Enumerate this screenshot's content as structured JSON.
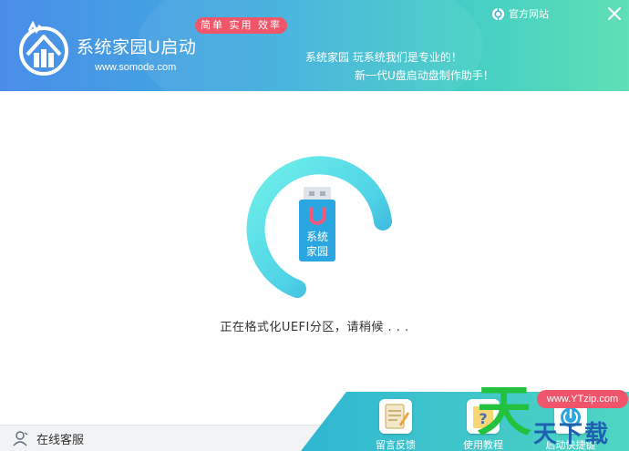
{
  "header": {
    "brand_title": "系统家园U启动",
    "brand_url": "www.somode.com",
    "slogan": "简单 实用 效率",
    "tagline_1": "系统家园 玩系统我们是专业的！",
    "tagline_2": "新一代U盘启动盘制作助手！",
    "official_site": "官方网站"
  },
  "main": {
    "usb_label_1": "系统",
    "usb_label_2": "家园",
    "status": "正在格式化UEFI分区，请稍候 . . ."
  },
  "footer": {
    "support_label": "在线客服",
    "tools": [
      {
        "label": "留言反馈"
      },
      {
        "label": "使用教程"
      },
      {
        "label": "启动快捷键"
      }
    ]
  },
  "watermark": {
    "big_char": "天",
    "chars": "天下载",
    "site": "www.YTzip.com"
  },
  "colors": {
    "header_start": "#4a8de9",
    "header_end": "#5fdfb6",
    "ring_start": "#6ff0ea",
    "ring_end": "#2f9fd6",
    "usb_body": "#2aa7e0",
    "badge": "#f0566a",
    "footer_slope": "#3cbfd6"
  }
}
